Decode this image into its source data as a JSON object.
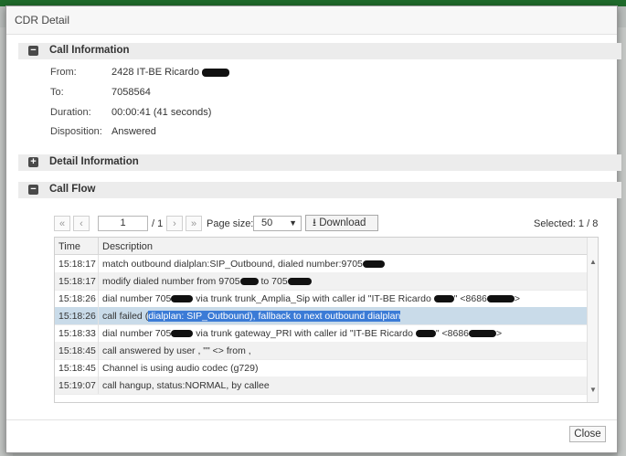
{
  "modal": {
    "title": "CDR Detail"
  },
  "sections": {
    "call_information": {
      "title": "Call Information",
      "toggle": "−"
    },
    "detail_information": {
      "title": "Detail Information",
      "toggle": "+"
    },
    "call_flow": {
      "title": "Call Flow",
      "toggle": "−"
    }
  },
  "info": {
    "from_label": "From:",
    "from_value": "2428 IT-BE Ricardo",
    "to_label": "To:",
    "to_value": "7058564",
    "duration_label": "Duration:",
    "duration_value": "00:00:41 (41 seconds)",
    "disposition_label": "Disposition:",
    "disposition_value": "Answered"
  },
  "pagination": {
    "first_icon": "«",
    "prev_icon": "‹",
    "next_icon": "›",
    "last_icon": "»",
    "page_value": "1",
    "total_pages": "/ 1",
    "page_size_label": "Page size:",
    "page_size_value": "50",
    "download_label": "Download",
    "selected_text": "Selected: 1 / 8"
  },
  "table": {
    "columns": [
      "Time",
      "Description"
    ],
    "rows": [
      {
        "time": "15:18:17",
        "desc": "match outbound dialplan:SIP_Outbound, dialed number:9705"
      },
      {
        "time": "15:18:17",
        "desc_a": "modify dialed number from 9705",
        "desc_b": " to 705"
      },
      {
        "time": "15:18:26",
        "desc_a": "dial number 705",
        "desc_b": " via trunk trunk_Amplia_Sip with caller id \"IT-BE Ricardo ",
        "desc_c": "\" <8686",
        "desc_d": ">"
      },
      {
        "time": "15:18:26",
        "desc_a": "call failed (",
        "desc_hl": "dialplan: SIP_Outbound), fallback to next outbound dialplan"
      },
      {
        "time": "15:18:33",
        "desc_a": "dial number 705",
        "desc_b": " via trunk gateway_PRI with caller id \"IT-BE Ricardo ",
        "desc_c": "\" <8686",
        "desc_d": ">"
      },
      {
        "time": "15:18:45",
        "desc": "call answered by user , \"\" <> from ,"
      },
      {
        "time": "15:18:45",
        "desc": "Channel is using audio codec (g729)"
      },
      {
        "time": "15:19:07",
        "desc": "call hangup, status:NORMAL, by callee"
      }
    ]
  },
  "footer": {
    "close_label": "Close"
  },
  "icons": {
    "download": "download-icon",
    "dropdown": "caret-down-icon",
    "scroll_up": "scroll-up-icon",
    "scroll_down": "scroll-down-icon"
  }
}
